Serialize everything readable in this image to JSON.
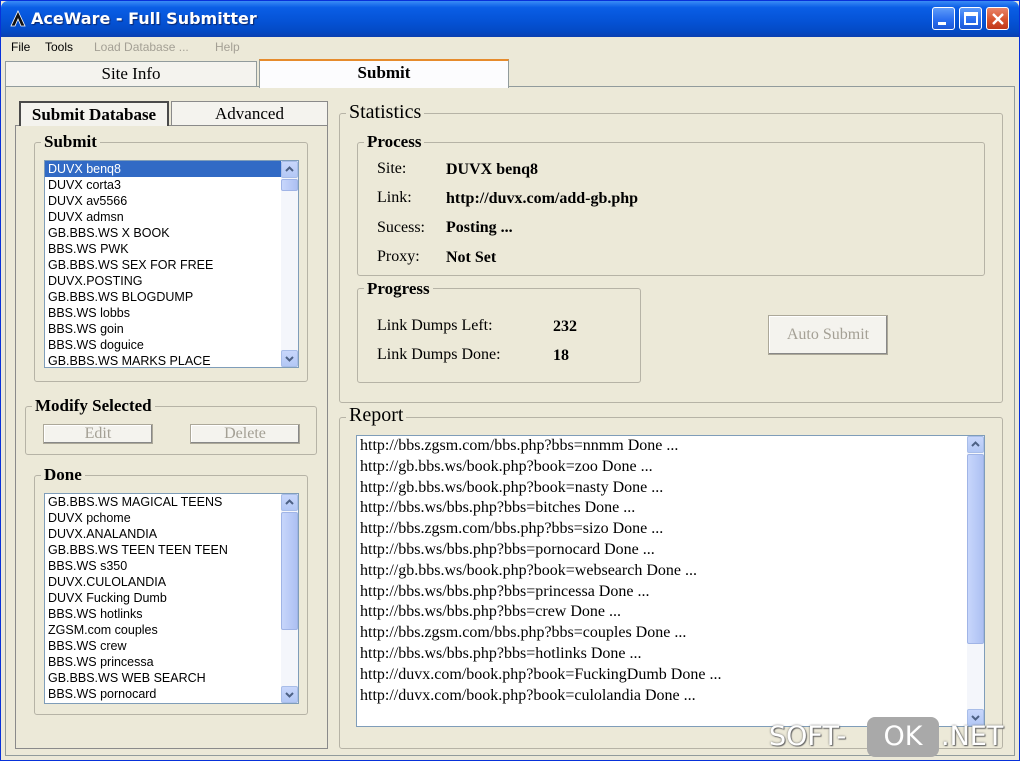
{
  "window": {
    "title": "AceWare - Full Submitter"
  },
  "menu": {
    "file": "File",
    "tools": "Tools",
    "load_database": "Load Database ...",
    "help": "Help"
  },
  "main_tabs": {
    "site_info": "Site Info",
    "submit": "Submit"
  },
  "sub_tabs": {
    "submit_database": "Submit Database",
    "advanced": "Advanced"
  },
  "submit_group": {
    "title": "Submit",
    "items": [
      "DUVX benq8",
      "DUVX corta3",
      "DUVX av5566",
      "DUVX admsn",
      "GB.BBS.WS X BOOK",
      "BBS.WS PWK",
      "GB.BBS.WS SEX FOR FREE",
      "DUVX.POSTING",
      "GB.BBS.WS BLOGDUMP",
      "BBS.WS lobbs",
      "BBS.WS goin",
      "BBS.WS doguice",
      "GB.BBS.WS MARKS PLACE"
    ],
    "selected_index": 0
  },
  "modify_group": {
    "title": "Modify Selected",
    "edit": "Edit",
    "delete": "Delete"
  },
  "done_group": {
    "title": "Done",
    "items": [
      "GB.BBS.WS MAGICAL TEENS",
      "DUVX pchome",
      "DUVX.ANALANDIA",
      "GB.BBS.WS TEEN TEEN TEEN",
      "BBS.WS s350",
      "DUVX.CULOLANDIA",
      "DUVX Fucking Dumb",
      "BBS.WS hotlinks",
      "ZGSM.com couples",
      "BBS.WS crew",
      "BBS.WS princessa",
      "GB.BBS.WS WEB SEARCH",
      "BBS.WS pornocard"
    ]
  },
  "statistics": {
    "title": "Statistics",
    "process": {
      "title": "Process",
      "site_label": "Site:",
      "site_value": "DUVX benq8",
      "link_label": "Link:",
      "link_value": "http://duvx.com/add-gb.php",
      "success_label": "Sucess:",
      "success_value": "Posting ...",
      "proxy_label": "Proxy:",
      "proxy_value": "Not Set"
    },
    "progress": {
      "title": "Progress",
      "left_label": "Link Dumps Left:",
      "left_value": "232",
      "done_label": "Link Dumps Done:",
      "done_value": "18"
    },
    "auto_submit": "Auto Submit"
  },
  "report": {
    "title": "Report",
    "lines": [
      "http://bbs.zgsm.com/bbs.php?bbs=nnmm Done ...",
      "http://gb.bbs.ws/book.php?book=zoo Done ...",
      "http://gb.bbs.ws/book.php?book=nasty Done ...",
      "http://bbs.ws/bbs.php?bbs=bitches Done ...",
      "http://bbs.zgsm.com/bbs.php?bbs=sizo Done ...",
      "http://bbs.ws/bbs.php?bbs=pornocard Done ...",
      "http://gb.bbs.ws/book.php?book=websearch Done ...",
      "http://bbs.ws/bbs.php?bbs=princessa Done ...",
      "http://bbs.ws/bbs.php?bbs=crew Done ...",
      "http://bbs.zgsm.com/bbs.php?bbs=couples Done ...",
      "http://bbs.ws/bbs.php?bbs=hotlinks Done ...",
      "http://duvx.com/book.php?book=FuckingDumb Done ...",
      "http://duvx.com/book.php?book=culolandia Done ..."
    ]
  },
  "watermark": {
    "soft": "SOFT-",
    "ok": "OK",
    "net": ".NET"
  },
  "colors": {
    "titlebar": "#0553d6",
    "selection": "#316ac5",
    "window_bg": "#ece9d8"
  }
}
